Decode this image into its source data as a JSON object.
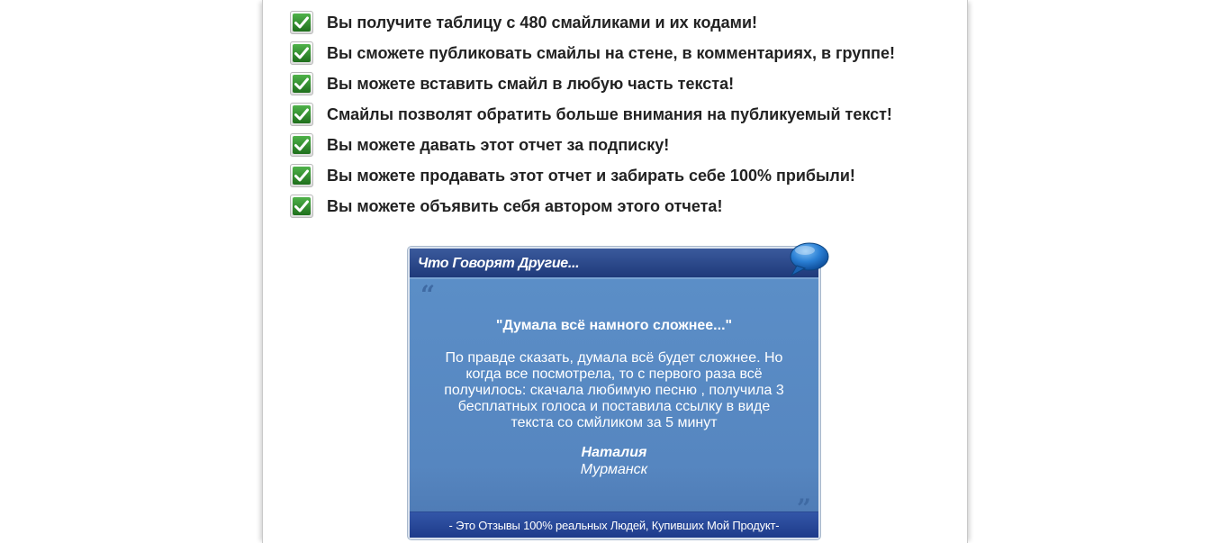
{
  "benefits": [
    "Вы получите таблицу с 480 смайликами и их кодами!",
    "Вы сможете публиковать смайлы на стене, в комментариях, в группе!",
    "Вы можете вставить смайл в любую часть текста!",
    "Смайлы позволят обратить больше внимания на публикуемый текст!",
    "Вы можете давать этот отчет за подписку!",
    "Вы можете продавать этот отчет и забирать себе 100% прибыли!",
    "Вы можете объявить себя автором этого отчета!"
  ],
  "benefit_icon": "checkmark-icon",
  "testimonial": {
    "title": "Что Говорят Другие...",
    "title_icon": "speech-bubble-icon",
    "quote_open": "“",
    "quote_close": "”",
    "headline": "\"Думала всё намного сложнее...\"",
    "text": "По правде сказать, думала всё будет сложнее. Но когда все посмотрела, то с первого раза всё получилось: скачала любимую песню , получила 3 бесплатных голоса и поставила ссылку в виде текста со смйликом за 5 минут",
    "author": "Наталия",
    "city": "Мурманск",
    "footer": "- Это Отзывы 100% реальных Людей, Купивших Мой Продукт-"
  },
  "colors": {
    "check_green": "#2e8b2a",
    "header_blue": "#1f3a7a",
    "body_blue": "#5b8ec7",
    "text_dark": "#222222"
  }
}
